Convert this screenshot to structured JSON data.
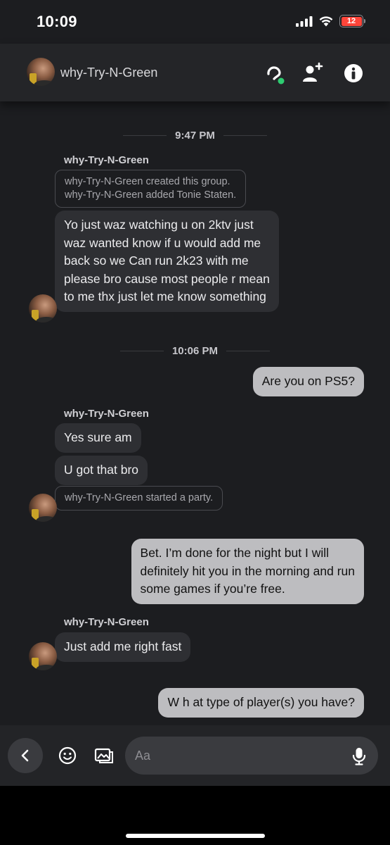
{
  "status_bar": {
    "time": "10:09",
    "battery": "12"
  },
  "header": {
    "title": "why-Try-N-Green",
    "icons": [
      "headset-icon",
      "add-friend-icon",
      "info-icon"
    ],
    "online_color": "#2ecc71"
  },
  "messages": {
    "divider_1": "9:47 PM",
    "sender_1": "why-Try-N-Green",
    "system_1_line1": "why-Try-N-Green created this group.",
    "system_1_line2": "why-Try-N-Green added Tonie Staten.",
    "in_1": [
      "Yo just waz watching u on 2ktv just",
      "waz wanted know if u would add me",
      "back so we Can run 2k23 with me",
      "please bro cause most people r mean",
      "to me thx just let me know something"
    ],
    "divider_2": "10:06 PM",
    "out_1": "Are you on PS5?",
    "sender_2": "why-Try-N-Green",
    "in_2": "Yes sure am",
    "in_3": "U got that bro",
    "system_2": "why-Try-N-Green started a party.",
    "out_2": [
      "Bet. I’m done for the night but I will",
      "definitely hit you in the morning and run",
      "some games if you’re free."
    ],
    "sender_3": "why-Try-N-Green",
    "in_4": "Just add me right fast",
    "out_3": "W h at type of player(s) you have?"
  },
  "input_bar": {
    "placeholder": "Aa",
    "icons": [
      "back-chevron-icon",
      "emoji-icon",
      "image-icon",
      "microphone-icon"
    ]
  },
  "colors": {
    "background": "#1c1d20",
    "incoming_bubble": "#2e2f33",
    "outgoing_bubble": "#bdbdc0",
    "battery_low": "#ff453a"
  }
}
